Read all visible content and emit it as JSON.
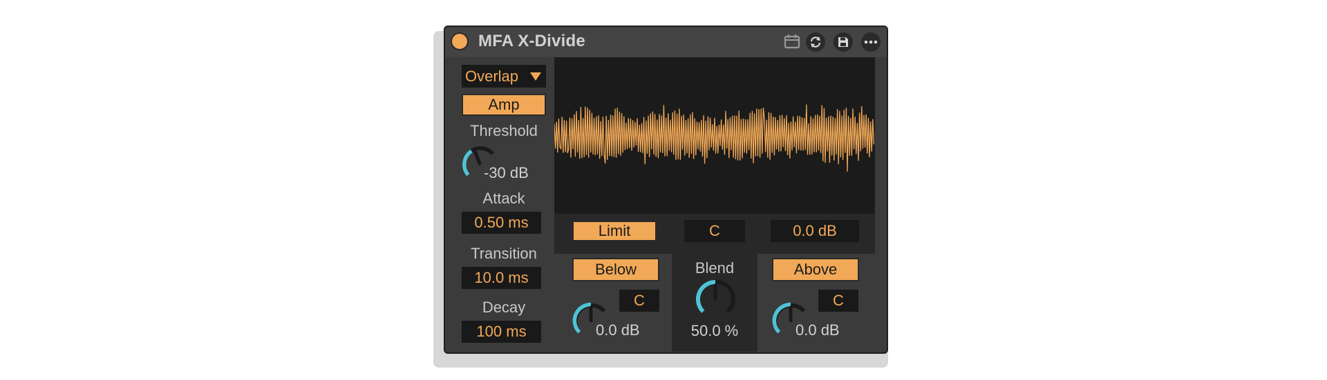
{
  "device": {
    "title": "MFA X-Divide",
    "colors": {
      "accent": "#f2a957",
      "knob_arc": "#4ec3d6",
      "body": "#3b3b3b",
      "display": "#1b1b1b"
    },
    "header_icons": [
      "calendar-icon",
      "refresh-icon",
      "save-icon",
      "more-icon"
    ]
  },
  "left": {
    "mode_dropdown": "Overlap",
    "amp_button": "Amp",
    "threshold": {
      "label": "Threshold",
      "value": "-30 dB",
      "level": 0.35
    },
    "attack": {
      "label": "Attack",
      "value": "0.50 ms"
    },
    "transition": {
      "label": "Transition",
      "value": "10.0 ms"
    },
    "decay": {
      "label": "Decay",
      "value": "100 ms"
    }
  },
  "display": {
    "limit_button": "Limit",
    "channel": "C",
    "gain": "0.0 dB"
  },
  "below": {
    "button": "Below",
    "channel": "C",
    "gain": "0.0 dB",
    "level": 0.5
  },
  "blend": {
    "label": "Blend",
    "value": "50.0 %",
    "level": 0.5
  },
  "above": {
    "button": "Above",
    "channel": "C",
    "gain": "0.0 dB",
    "level": 0.5
  }
}
